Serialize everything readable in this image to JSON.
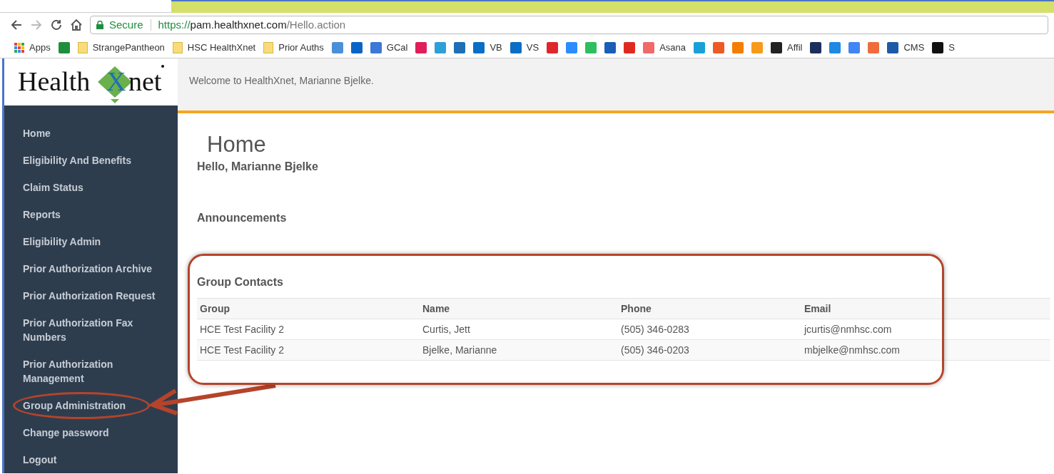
{
  "browser": {
    "secure_label": "Secure",
    "url_scheme": "https://",
    "url_host": "pam.healthxnet.com",
    "url_path": "/Hello.action",
    "bookmarks": [
      {
        "kind": "apps",
        "label": "Apps"
      },
      {
        "kind": "app",
        "color": "#1e8e3e"
      },
      {
        "kind": "folder",
        "label": "StrangePantheon"
      },
      {
        "kind": "folder",
        "label": "HSC HealthXnet"
      },
      {
        "kind": "folder",
        "label": "Prior Auths"
      },
      {
        "kind": "app",
        "color": "#4a90d9"
      },
      {
        "kind": "app",
        "color": "#0a64c8"
      },
      {
        "kind": "app",
        "color": "#3b78d8",
        "label": "GCal"
      },
      {
        "kind": "app",
        "color": "#e01e5a"
      },
      {
        "kind": "app",
        "color": "#2d9fd9"
      },
      {
        "kind": "app",
        "color": "#1e6fb5"
      },
      {
        "kind": "app",
        "color": "#0a6ec6",
        "label": "VB"
      },
      {
        "kind": "app",
        "color": "#0a6ec6",
        "label": "VS"
      },
      {
        "kind": "app",
        "color": "#e0262b"
      },
      {
        "kind": "app",
        "color": "#2d8cff"
      },
      {
        "kind": "app",
        "color": "#2dbe60"
      },
      {
        "kind": "app",
        "color": "#1b5eb8"
      },
      {
        "kind": "app",
        "color": "#e02a20"
      },
      {
        "kind": "app",
        "color": "#f06a6a",
        "label": "Asana"
      },
      {
        "kind": "app",
        "color": "#1aa0d8"
      },
      {
        "kind": "app",
        "color": "#ee5a24"
      },
      {
        "kind": "app",
        "color": "#f57d00"
      },
      {
        "kind": "app",
        "color": "#f79a1c"
      },
      {
        "kind": "app",
        "color": "#222222",
        "label": "Affil"
      },
      {
        "kind": "app",
        "color": "#1c2e5c"
      },
      {
        "kind": "app",
        "color": "#1e88e5"
      },
      {
        "kind": "app",
        "color": "#4285f4"
      },
      {
        "kind": "app",
        "color": "#ef6c3c"
      },
      {
        "kind": "app",
        "color": "#1e5aa8",
        "label": "CMS"
      },
      {
        "kind": "app",
        "color": "#111111",
        "label": "S"
      }
    ]
  },
  "logo": {
    "before": "Health",
    "mark": "X",
    "after": "net"
  },
  "header": {
    "welcome": "Welcome to HealthXnet, Marianne Bjelke."
  },
  "sidebar": {
    "items": [
      {
        "label": "Home",
        "circled": false
      },
      {
        "label": "Eligibility And Benefits",
        "circled": false
      },
      {
        "label": "Claim Status",
        "circled": false
      },
      {
        "label": "Reports",
        "circled": false
      },
      {
        "label": "Eligibility Admin",
        "circled": false
      },
      {
        "label": "Prior Authorization Archive",
        "circled": false
      },
      {
        "label": "Prior Authorization Request",
        "circled": false
      },
      {
        "label": "Prior Authorization Fax Numbers",
        "circled": false
      },
      {
        "label": "Prior Authorization Management",
        "circled": false
      },
      {
        "label": "Group Administration",
        "circled": true
      },
      {
        "label": "Change password",
        "circled": false
      },
      {
        "label": "Logout",
        "circled": false
      }
    ]
  },
  "page": {
    "title": "Home",
    "greeting": "Hello, Marianne Bjelke",
    "announcements_heading": "Announcements"
  },
  "group_contacts": {
    "title": "Group Contacts",
    "framed": true,
    "columns": [
      "Group",
      "Name",
      "Phone",
      "Email"
    ],
    "rows": [
      [
        "HCE Test Facility 2",
        "Curtis, Jett",
        "(505) 346-0283",
        "jcurtis@nmhsc.com"
      ],
      [
        "HCE Test Facility 2",
        "Bjelke, Marianne",
        "(505) 346-0203",
        "mbjelke@nmhsc.com"
      ]
    ]
  }
}
